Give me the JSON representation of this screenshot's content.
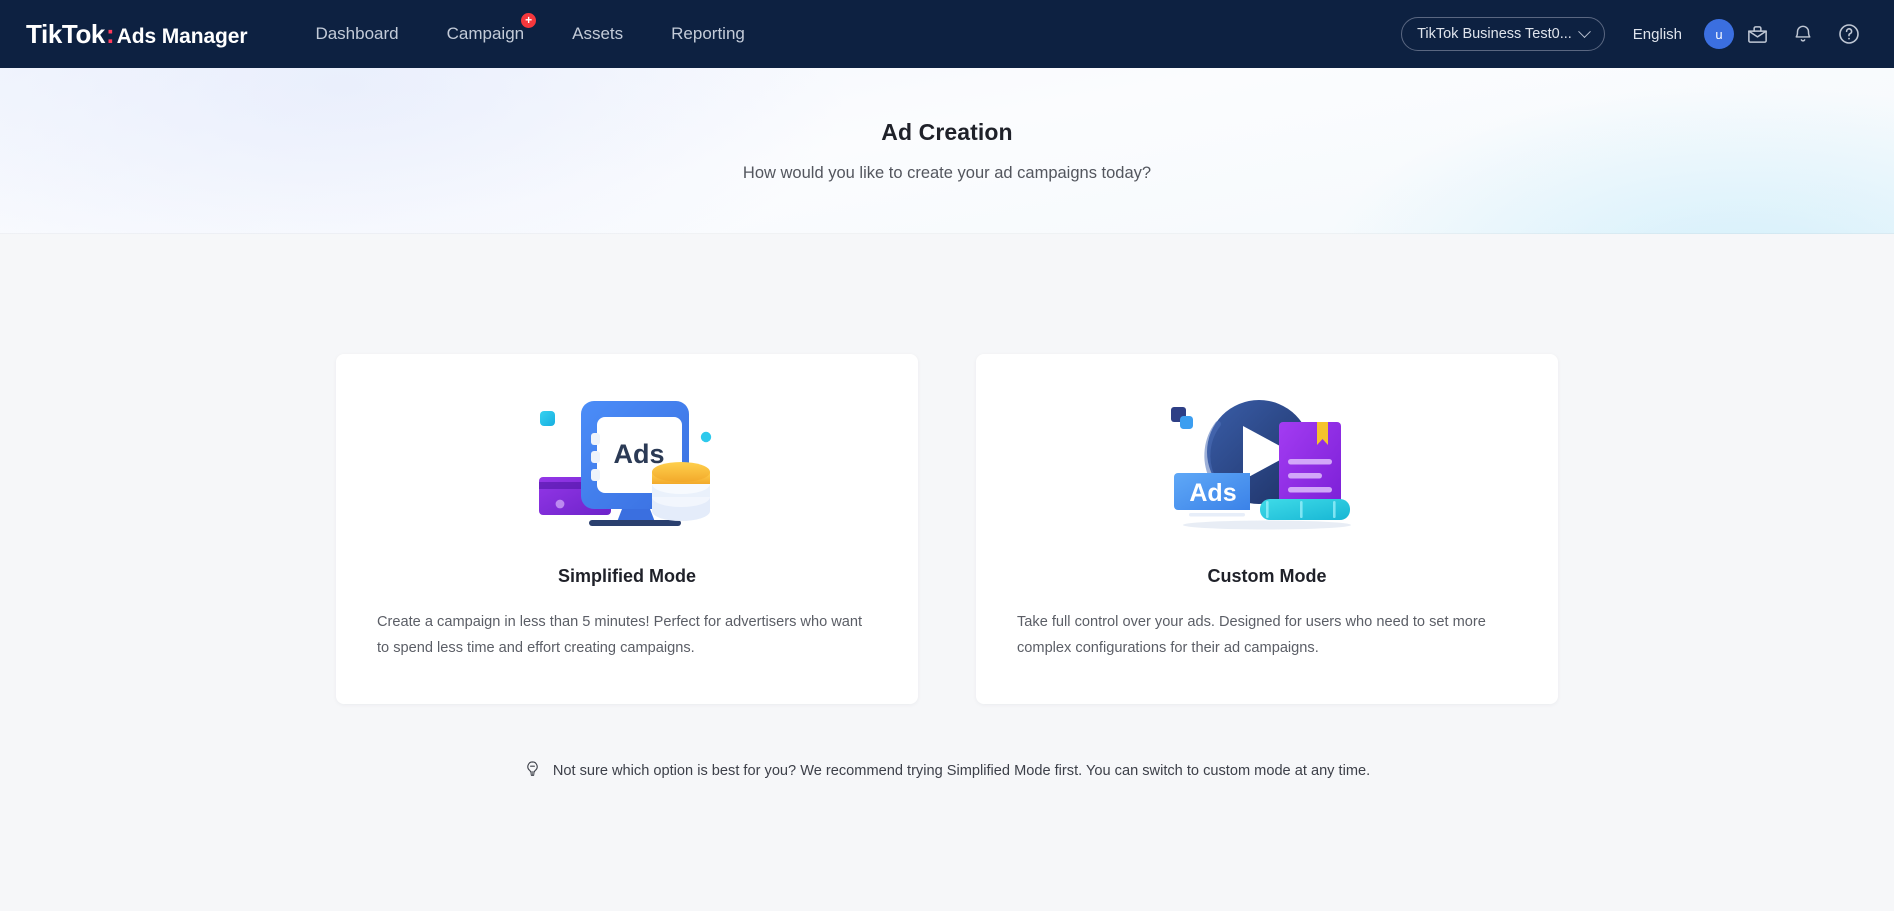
{
  "header": {
    "brand": {
      "tiktok": "TikTok",
      "colon": ":",
      "suffix": "Ads Manager"
    },
    "nav": [
      {
        "label": "Dashboard",
        "badge": ""
      },
      {
        "label": "Campaign",
        "badge": "+"
      },
      {
        "label": "Assets",
        "badge": ""
      },
      {
        "label": "Reporting",
        "badge": ""
      }
    ],
    "account": {
      "name": "TikTok Business Test0...",
      "icon": "chevron-down-icon"
    },
    "language": "English",
    "avatar_initial": "u",
    "icons": [
      "briefcase-inbox-icon",
      "bell-icon",
      "help-circle-icon"
    ]
  },
  "hero": {
    "title": "Ad Creation",
    "subtitle": "How would you like to create your ad campaigns today?"
  },
  "cards": [
    {
      "illustration": "ads-tablet-coins-illustration",
      "title": "Simplified Mode",
      "description": "Create a campaign in less than 5 minutes! Perfect for advertisers who want to spend less time and effort creating campaigns.",
      "illustration_label": "Ads"
    },
    {
      "illustration": "play-book-ads-illustration",
      "title": "Custom Mode",
      "description": "Take full control over your ads. Designed for users who need to set more complex configurations for their ad campaigns.",
      "illustration_label": "Ads"
    }
  ],
  "note": {
    "icon": "lightbulb-icon",
    "text": "Not sure which option is best for you? We recommend trying Simplified Mode first. You can switch to custom mode at any time."
  },
  "colors": {
    "nav_bg": "#0d2141",
    "brand_accent": "#ff3b5c",
    "badge_red": "#f5373c",
    "avatar_blue": "#3b6fe0",
    "page_bg": "#f6f7f9",
    "card_bg": "#ffffff",
    "text_primary": "#1f2129",
    "text_secondary": "#5b5e66"
  }
}
